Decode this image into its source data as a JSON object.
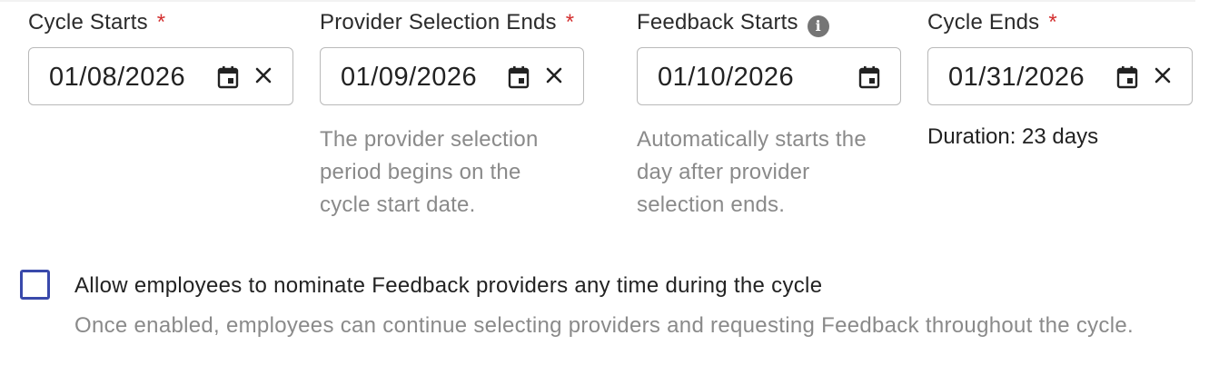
{
  "fields": [
    {
      "label": "Cycle Starts",
      "required_mark": "*",
      "value": "01/08/2026",
      "has_clear": true,
      "help": "",
      "icons": [
        "calendar-icon",
        "close-icon"
      ]
    },
    {
      "label": "Provider Selection Ends",
      "required_mark": "*",
      "value": "01/09/2026",
      "has_clear": true,
      "help": "The provider selection period begins on the cycle start date.",
      "icons": [
        "calendar-icon",
        "close-icon"
      ]
    },
    {
      "label": "Feedback Starts",
      "info_icon": "i",
      "value": "01/10/2026",
      "has_clear": false,
      "help": "Automatically starts the day after provider selection ends.",
      "icons": [
        "info-icon",
        "calendar-icon"
      ]
    },
    {
      "label": "Cycle Ends",
      "required_mark": "*",
      "value": "01/31/2026",
      "has_clear": true,
      "duration": "Duration: 23 days",
      "icons": [
        "calendar-icon",
        "close-icon"
      ]
    }
  ],
  "nomination": {
    "checked": false,
    "label": "Allow employees to nominate Feedback providers any time during the cycle",
    "description": "Once enabled, employees can continue selecting providers and requesting Feedback throughout the cycle."
  },
  "colors": {
    "required": "#d32f2f",
    "checkbox_border": "#3949ab",
    "helper_text": "#8a8a8a",
    "input_border": "#b9b9b9"
  }
}
